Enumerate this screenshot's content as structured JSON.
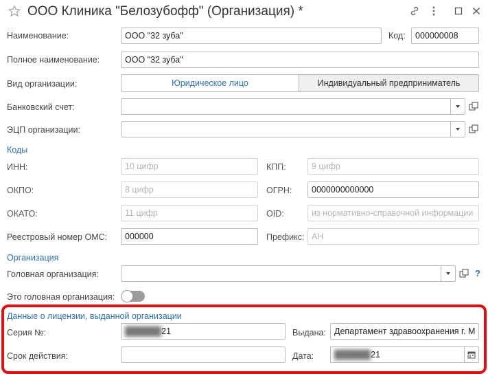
{
  "header": {
    "title": "ООО Клиника \"Белозубофф\" (Организация) *"
  },
  "fields": {
    "name_label": "Наименование:",
    "name_value": "ООО \"32 зуба\"",
    "code_label": "Код:",
    "code_value": "000000008",
    "full_name_label": "Полное наименование:",
    "full_name_value": "ООО \"32 зуба\"",
    "org_type_label": "Вид организации:",
    "org_type_options": [
      "Юридическое лицо",
      "Индивидуальный предприниматель"
    ],
    "org_type_selected": "Юридическое лицо",
    "bank_label": "Банковский счет:",
    "ecp_label": "ЭЦП организации:"
  },
  "codes": {
    "section_title": "Коды",
    "inn_label": "ИНН:",
    "inn_placeholder": "10 цифр",
    "kpp_label": "КПП:",
    "kpp_placeholder": "9 цифр",
    "okpo_label": "ОКПО:",
    "okpo_placeholder": "8 цифр",
    "ogrn_label": "ОГРН:",
    "ogrn_value": "0000000000000",
    "okato_label": "ОКАТО:",
    "okato_placeholder": "11 цифр",
    "oid_label": "OID:",
    "oid_placeholder": "из нормативно-справочной информации",
    "oms_label": "Реестровый номер ОМС:",
    "oms_value": "000000",
    "prefix_label": "Префикс:",
    "prefix_value": "АН"
  },
  "organization": {
    "section_title": "Организация",
    "head_org_label": "Головная организация:",
    "help_mark": "?",
    "is_head_label": "Это головная организация:",
    "is_head_value": false
  },
  "license": {
    "section_title": "Данные о лицензии, выданной организации",
    "series_label": "Серия №:",
    "series_value_visible": "21",
    "issued_label": "Выдана:",
    "issued_value": "Департамент здравоохранения г. М",
    "validity_label": "Срок действия:",
    "date_label": "Дата:",
    "date_value_visible": "21"
  },
  "colors": {
    "accent": "#2d6fb6",
    "highlight": "#e01010"
  }
}
